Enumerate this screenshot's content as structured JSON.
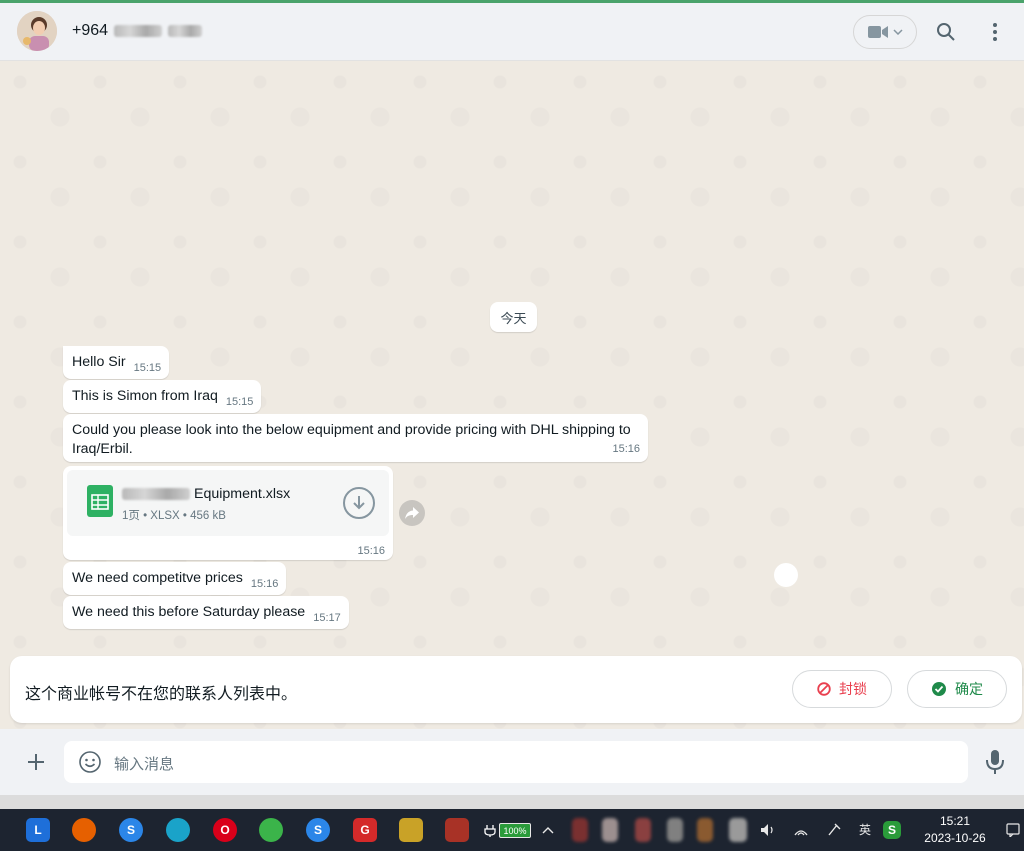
{
  "header": {
    "contact_number": "+964",
    "contact_hidden_hint": "blurred"
  },
  "chat": {
    "day_separator": "今天",
    "messages": [
      {
        "text": "Hello Sir",
        "time": "15:15"
      },
      {
        "text": "This is Simon from Iraq",
        "time": "15:15"
      },
      {
        "text": "Could you please look into the below equipment and provide pricing with DHL shipping to Iraq/Erbil.",
        "time": "15:16"
      },
      {
        "text": "We need competitve prices",
        "time": "15:16"
      },
      {
        "text": "We need this before Saturday please",
        "time": "15:17"
      }
    ],
    "file": {
      "name": "Equipment.xlsx",
      "meta": "1页 • XLSX • 456 kB",
      "time": "15:16"
    }
  },
  "banner": {
    "text": "这个商业帐号不在您的联系人列表中。",
    "block_label": "封锁",
    "ok_label": "确定"
  },
  "composer": {
    "placeholder": "输入消息"
  },
  "taskbar": {
    "battery": "100%",
    "ime": "英",
    "time": "15:21",
    "date": "2023-10-26"
  },
  "colors": {
    "accent": "#4aa36b",
    "danger": "#e9404f",
    "confirm": "#1f8a4a"
  }
}
